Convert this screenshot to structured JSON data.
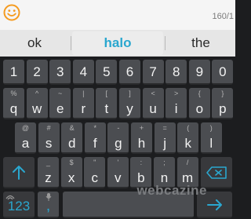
{
  "topbar": {
    "counter": "160/1"
  },
  "suggestions": [
    "ok",
    "halo",
    "the"
  ],
  "numbers": [
    "1",
    "2",
    "3",
    "4",
    "5",
    "6",
    "7",
    "8",
    "9",
    "0"
  ],
  "row1": [
    {
      "k": "q",
      "s": "%"
    },
    {
      "k": "w",
      "s": "^"
    },
    {
      "k": "e",
      "s": "~"
    },
    {
      "k": "r",
      "s": "|"
    },
    {
      "k": "t",
      "s": "["
    },
    {
      "k": "y",
      "s": "]"
    },
    {
      "k": "u",
      "s": "<"
    },
    {
      "k": "i",
      "s": ">"
    },
    {
      "k": "o",
      "s": "{"
    },
    {
      "k": "p",
      "s": "}"
    }
  ],
  "row2": [
    {
      "k": "a",
      "s": "@"
    },
    {
      "k": "s",
      "s": "#"
    },
    {
      "k": "d",
      "s": "&"
    },
    {
      "k": "f",
      "s": "*"
    },
    {
      "k": "g",
      "s": "-"
    },
    {
      "k": "h",
      "s": "+"
    },
    {
      "k": "j",
      "s": "="
    },
    {
      "k": "k",
      "s": "("
    },
    {
      "k": "l",
      "s": ")"
    }
  ],
  "row3": [
    {
      "k": "z",
      "s": "_"
    },
    {
      "k": "x",
      "s": "$"
    },
    {
      "k": "c",
      "s": "\""
    },
    {
      "k": "v",
      "s": "'"
    },
    {
      "k": "b",
      "s": ":"
    },
    {
      "k": "n",
      "s": ";"
    },
    {
      "k": "m",
      "s": "/"
    }
  ],
  "bottom": {
    "num_label": "123",
    "comma": ",",
    "comma_sub": "",
    "period": "."
  },
  "watermark": "webcazine",
  "colors": {
    "accent": "#2aa7cf",
    "key": "#4b4d51",
    "background": "#1c1d1f"
  }
}
